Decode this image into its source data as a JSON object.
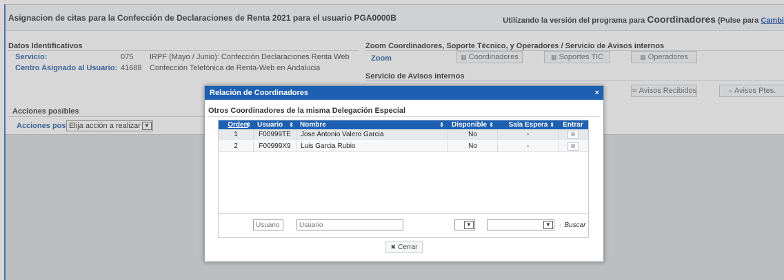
{
  "header": {
    "title": "Asignacion de citas para la Confección de Declaraciones de Renta 2021 para el usuario PGA0000B",
    "version_prefix": "Utilizando la versión del programa para",
    "version_role": "Coordinadores",
    "version_suffix": "(Pulse para",
    "version_link": "Cambi"
  },
  "datos": {
    "title": "Datos Identificativos",
    "servicio_label": "Servicio:",
    "servicio_code": "075",
    "servicio_desc": "IRPF (Mayo / Junio): Confección Declaraciones Renta Web",
    "centro_label": "Centro Asignado al Usuario:",
    "centro_code": "41688",
    "centro_desc": "Confección Telefónica de Renta-Web en Andalucia"
  },
  "zoom": {
    "title": "Zoom Coordinadores, Soporte Técnico, y Operadores / Servicio de Avisos internos",
    "label": "Zoom",
    "btn_coordinadores": "Coordinadores",
    "btn_soportes": "Soportes TIC",
    "btn_operadores": "Operadores"
  },
  "avisos": {
    "title": "Servicio de Avisos internos",
    "btn_recibidos": "Avisos Recibidos",
    "btn_pendientes": "Avisos Ptes."
  },
  "acciones": {
    "title": "Acciones posibles",
    "label": "Acciones posibles",
    "select_value": "Elija acción a realizar"
  },
  "modal": {
    "title": "Relación de Coordinadores",
    "close": "×",
    "subtitle": "Otros Coordinadores de la misma Delegación Especial",
    "columns": {
      "orden": "Orden",
      "usuario": "Usuario",
      "nombre": "Nombre",
      "disponible": "Disponible",
      "sala": "Sala Espera",
      "entrar": "Entrar"
    },
    "rows": [
      {
        "orden": "1",
        "usuario": "F00999TE",
        "nombre": "Jose Antonio Valero Garcia",
        "disponible": "No",
        "sala": "-"
      },
      {
        "orden": "2",
        "usuario": "F00999X9",
        "nombre": "Luis Garcia Rubio",
        "disponible": "No",
        "sala": "-"
      }
    ],
    "filter": {
      "usuario_placeholder": "Usuario",
      "nombre_placeholder": "Usuario",
      "buscar": "Buscar"
    },
    "cerrar": "Cerrar"
  },
  "colors": {
    "brand_blue": "#1d5fb0",
    "label_blue": "#2a5fa8"
  }
}
